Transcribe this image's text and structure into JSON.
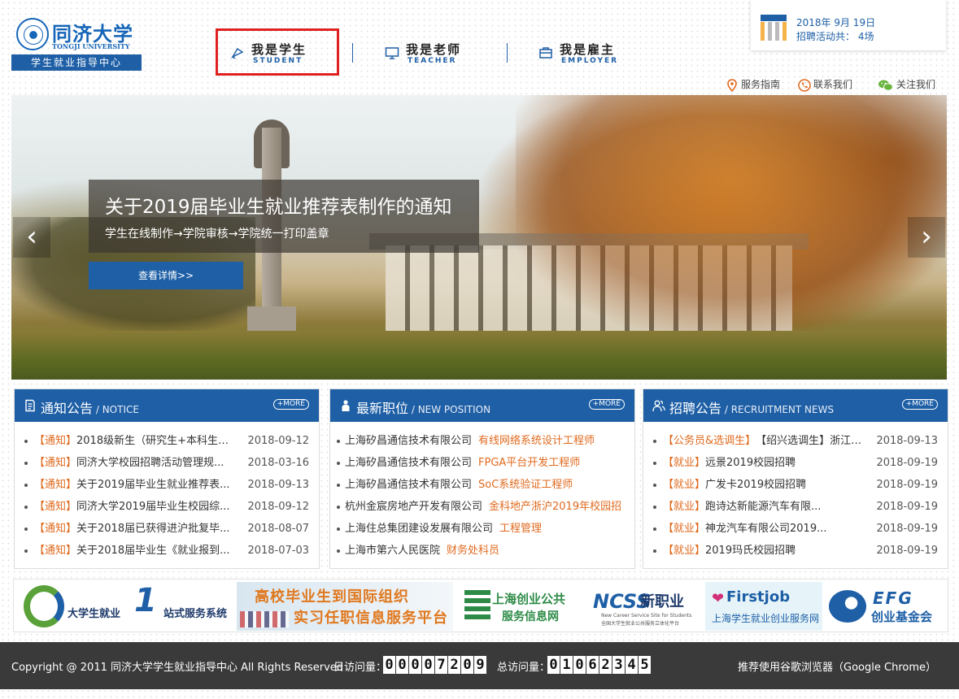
{
  "header": {
    "logo": {
      "cn": "同济大学",
      "en": "TONGJI UNIVERSITY",
      "bar": "学生就业指导中心"
    },
    "nav": [
      {
        "cn": "我是学生",
        "en": "STUDENT",
        "icon": "student-icon"
      },
      {
        "cn": "我是老师",
        "en": "TEACHER",
        "icon": "monitor-icon"
      },
      {
        "cn": "我是雇主",
        "en": "EMPLOYER",
        "icon": "briefcase-icon"
      }
    ],
    "date_card": {
      "date": "2018年 9月 19日",
      "activities": "招聘活动共： 4场"
    },
    "utility_links": [
      {
        "label": "服务指南",
        "icon": "location-pin-icon"
      },
      {
        "label": "联系我们",
        "icon": "phone-icon"
      },
      {
        "label": "关注我们",
        "icon": "wechat-icon"
      }
    ]
  },
  "banner": {
    "title": "关于2019届毕业生就业推荐表制作的通知",
    "subtitle": "学生在线制作→学院审核→学院统一打印盖章",
    "button": "查看详情>>",
    "prev": "‹",
    "next": "›"
  },
  "panels": {
    "notice": {
      "title": "通知公告",
      "en": " / NOTICE",
      "more": "+MORE",
      "items": [
        {
          "tag": "【通知】",
          "text": "2018级新生（研究生+本科生）...",
          "date": "2018-09-12"
        },
        {
          "tag": "【通知】",
          "text": "同济大学校园招聘活动管理规...",
          "date": "2018-03-16"
        },
        {
          "tag": "【通知】",
          "text": "关于2019届毕业生就业推荐表...",
          "date": "2018-09-13"
        },
        {
          "tag": "【通知】",
          "text": "同济大学2019届毕业生校园综...",
          "date": "2018-09-12"
        },
        {
          "tag": "【通知】",
          "text": "关于2018届已获得进沪批复毕...",
          "date": "2018-08-07"
        },
        {
          "tag": "【通知】",
          "text": "关于2018届毕业生《就业报到...",
          "date": "2018-07-03"
        }
      ]
    },
    "positions": {
      "title": "最新职位",
      "en": " / NEW POSITION",
      "more": "+MORE",
      "items": [
        {
          "company": "上海矽昌通信技术有限公司",
          "job": "有线网络系统设计工程师"
        },
        {
          "company": "上海矽昌通信技术有限公司",
          "job": "FPGA平台开发工程师"
        },
        {
          "company": "上海矽昌通信技术有限公司",
          "job": "SoC系统验证工程师"
        },
        {
          "company": "杭州金宸房地产开发有限公司",
          "job": "金科地产浙沪2019年校园招"
        },
        {
          "company": "上海住总集团建设发展有限公司",
          "job": "工程管理"
        },
        {
          "company": "上海市第六人民医院",
          "job": "财务处科员"
        }
      ]
    },
    "recruitment": {
      "title": "招聘公告",
      "en": " / RECRUITMENT NEWS",
      "more": "+MORE",
      "items": [
        {
          "tag": "【公务员&选调生】",
          "text": "【绍兴选调生】浙江省...",
          "date": "2018-09-13"
        },
        {
          "tag": "【就业】",
          "text": "远景2019校园招聘",
          "date": "2018-09-19"
        },
        {
          "tag": "【就业】",
          "text": "广发卡2019校园招聘",
          "date": "2018-09-19"
        },
        {
          "tag": "【就业】",
          "text": "跑诗达新能源汽车有限...",
          "date": "2018-09-19"
        },
        {
          "tag": "【就业】",
          "text": "神龙汽车有限公司2019...",
          "date": "2018-09-19"
        },
        {
          "tag": "【就业】",
          "text": "2019玛氏校园招聘",
          "date": "2018-09-19"
        }
      ]
    }
  },
  "partners": {
    "p1": {
      "text": "大学生就业",
      "one": "1",
      "text2": "站式服务系统"
    },
    "p2": {
      "l1": "高校毕业生到国际组织",
      "l2": "实习任职信息服务平台"
    },
    "p3": {
      "l1": "上海创业公共",
      "l2": "服务信息网"
    },
    "p4": {
      "logo": "NCSS",
      "cn": "新职业",
      "s1": "New Career Service Site for Students",
      "s2": "全国大学生就业公共服务立体化平台"
    },
    "p5": {
      "logo": "Firstjob",
      "l2": "上海学生就业创业服务网"
    },
    "p6": {
      "logo": "EFG",
      "l2": "创业基金会"
    }
  },
  "footer": {
    "copyright": "Copyright @ 2011 同济大学学生就业指导中心 All Rights Reserved",
    "daily_label": "日访问量：",
    "daily_digits": [
      "0",
      "0",
      "0",
      "0",
      "7",
      "2",
      "0",
      "9"
    ],
    "total_label": "总访问量：",
    "total_digits": [
      "0",
      "1",
      "0",
      "6",
      "2",
      "3",
      "4",
      "5"
    ],
    "recommend": "推荐使用谷歌浏览器（Google Chrome）"
  },
  "colors": {
    "primary": "#1e5fa6",
    "accent_orange": "#e06a1e",
    "active_highlight": "#e02020",
    "footer_bg": "#3a3a3a"
  }
}
